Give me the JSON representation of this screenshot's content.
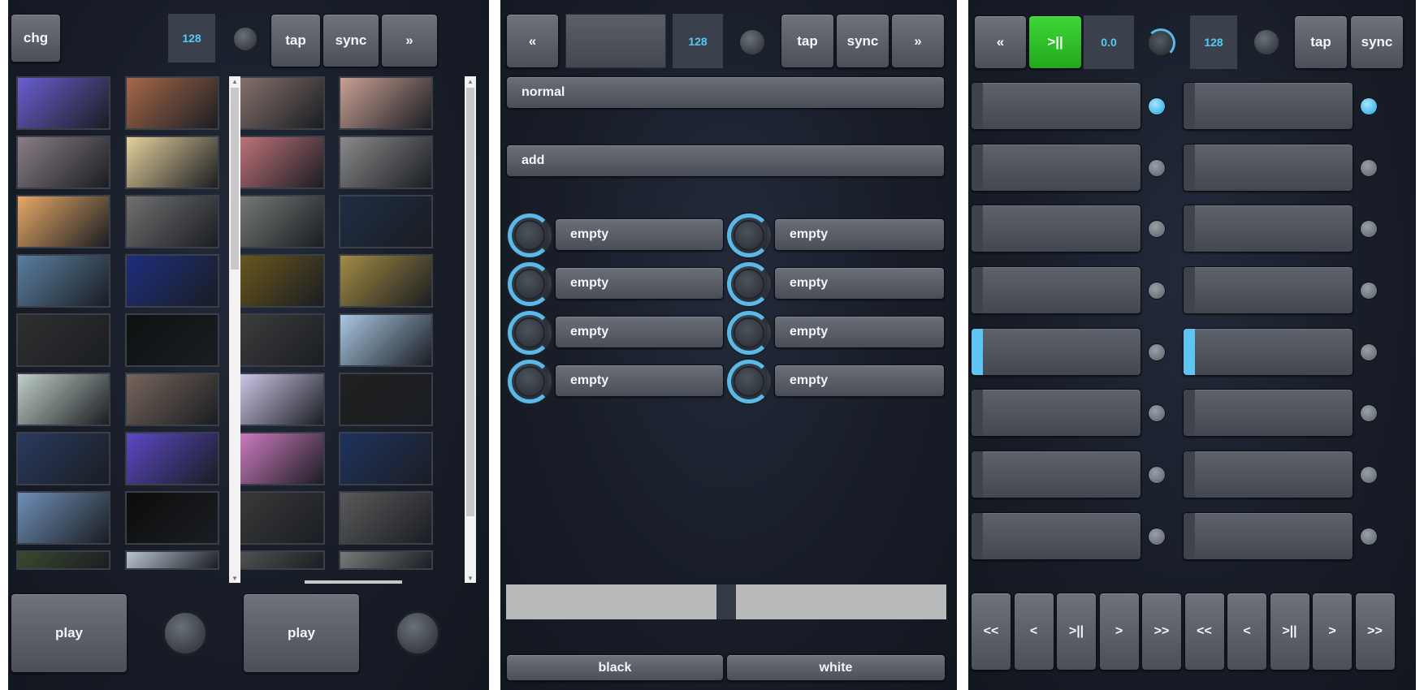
{
  "left": {
    "chg_label": "chg",
    "bpm": "128",
    "tap_label": "tap",
    "sync_label": "sync",
    "next_label": "»",
    "play_a_label": "play",
    "play_b_label": "play",
    "thumbs_a": [
      "#6a5fd0",
      "#a7694a",
      "#8b7670",
      "#c9a095",
      "#8a7e86",
      "#e6d19c",
      "#c8777e",
      "#8a8a8a",
      "#e6a867",
      "#707070",
      "#7a7f7b",
      "#1e2d45",
      "#5a7fa0",
      "#1d2e7e",
      "#6d5a1c",
      "#a38b43",
      "#2f2f2f",
      "#0d1111",
      "#3e3e3e",
      "#a9c7e3",
      "#c1cfc9",
      "#76655b",
      "#d7d0f2",
      "#202020",
      "#2a3a60",
      "#5b48c5",
      "#d880c9",
      "#1f3360",
      "#6f8fb8",
      "#0c0c0c",
      "#3b3b3b",
      "#5a5a5a",
      "#3a4a30",
      "#b8c4d0",
      "#555555",
      "#7a7a7a"
    ]
  },
  "middle": {
    "prev_label": "«",
    "bpm": "128",
    "tap_label": "tap",
    "sync_label": "sync",
    "next_label": "»",
    "blend_top": "normal",
    "blend_bottom": "add",
    "effects_left": [
      "empty",
      "empty",
      "empty",
      "empty"
    ],
    "effects_right": [
      "empty",
      "empty",
      "empty",
      "empty"
    ],
    "black_label": "black",
    "white_label": "white",
    "crossfader_position": 0.5
  },
  "right": {
    "prev_label": "«",
    "play_pause_label": ">||",
    "position": "0.0",
    "bpm": "128",
    "tap_label": "tap",
    "sync_label": "sync",
    "clip_slots_left_active": [
      false,
      false,
      false,
      false,
      true,
      false,
      false,
      false
    ],
    "clip_slots_right_active": [
      false,
      false,
      false,
      false,
      true,
      false,
      false,
      false
    ],
    "leds_left_on": [
      true,
      false,
      false,
      false,
      false,
      false,
      false,
      false
    ],
    "leds_right_on": [
      true,
      false,
      false,
      false,
      false,
      false,
      false,
      false
    ],
    "transport_a": [
      "<<",
      "<",
      ">||",
      ">",
      ">>"
    ],
    "transport_b": [
      "<<",
      "<",
      ">||",
      ">",
      ">>"
    ]
  },
  "colors": {
    "accent": "#57c8f5",
    "play_active": "#2fc22a",
    "background": "#181d28"
  }
}
